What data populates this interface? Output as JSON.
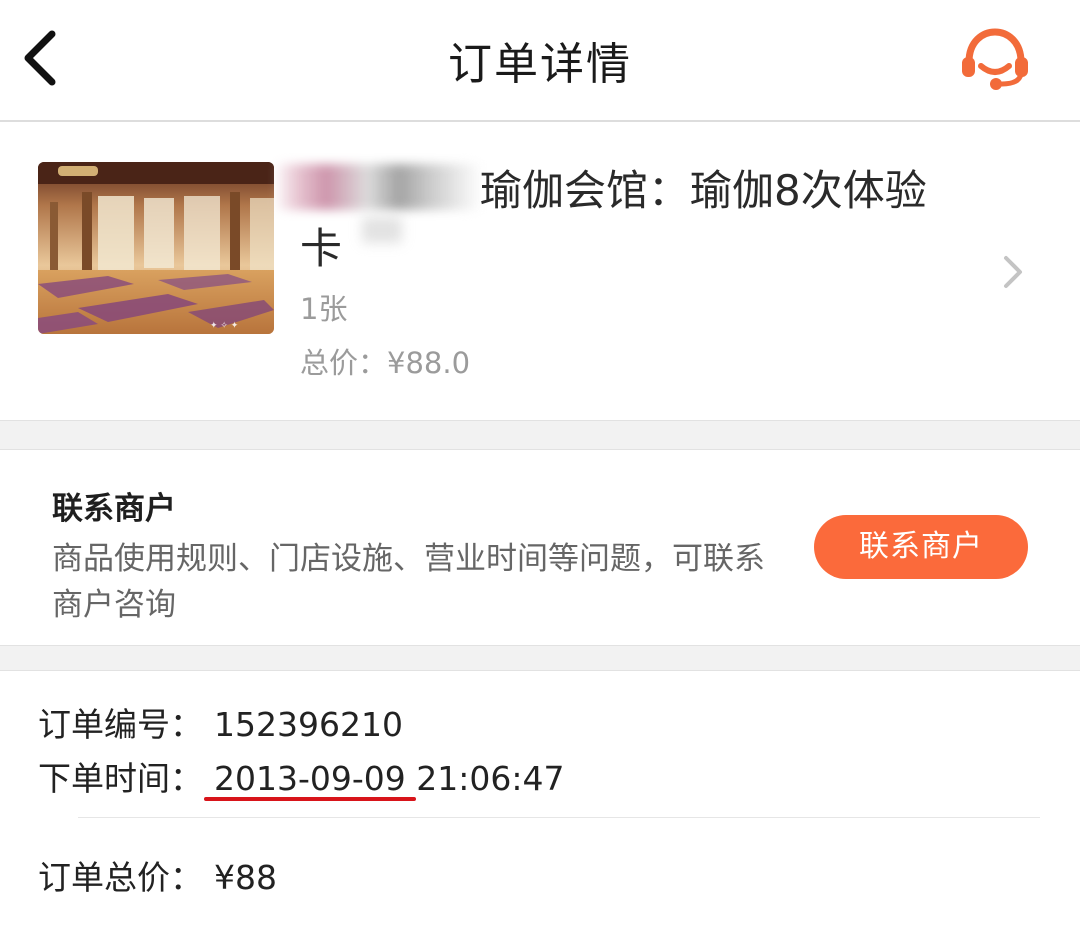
{
  "header": {
    "title": "订单详情",
    "back_icon": "chevron-left-icon",
    "customer_service_icon": "headset-icon",
    "accent_color": "#f26b3a"
  },
  "product": {
    "name": "瑜伽会馆：瑜伽8次体验卡",
    "quantity": "1张",
    "total_label": "总价：",
    "total_value": "¥88.0",
    "chevron_icon": "chevron-right-icon"
  },
  "contact": {
    "heading": "联系商户",
    "description": "商品使用规则、门店设施、营业时间等问题，可联系商户咨询",
    "button_label": "联系商户",
    "button_color": "#fb6a3b"
  },
  "order": {
    "number_label": "订单编号：",
    "number_value": "152396210",
    "time_label": "下单时间：",
    "time_value": "2013-09-09 21:06:47",
    "total_label": "订单总价：",
    "total_value": "¥88",
    "underline_color": "#d8141a"
  }
}
